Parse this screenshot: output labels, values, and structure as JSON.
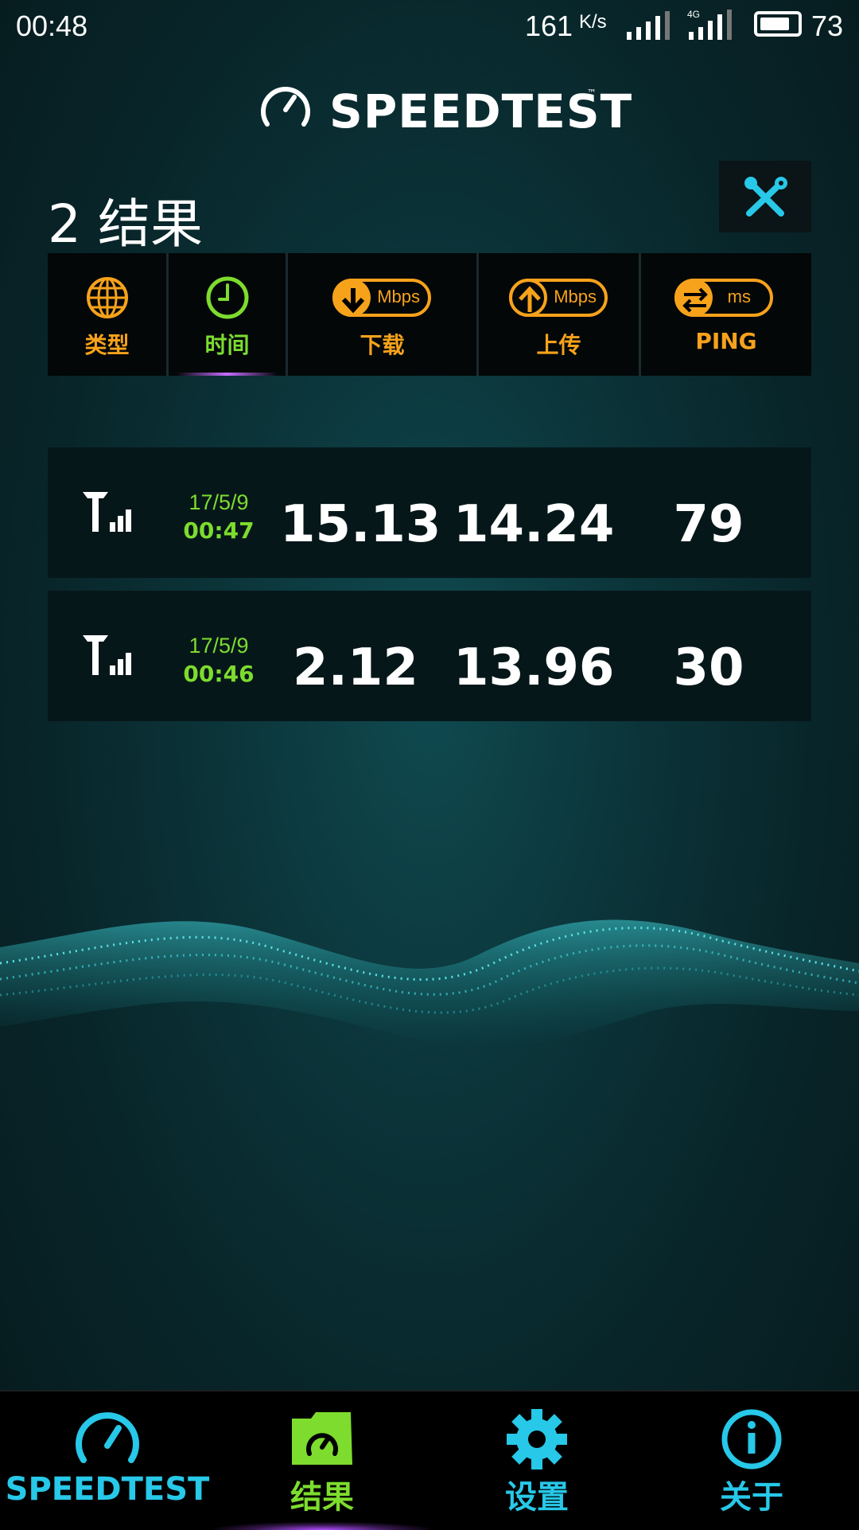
{
  "status_bar": {
    "time": "00:48",
    "net_speed": "161",
    "net_speed_unit": "K/s",
    "network_type": "4G",
    "battery": "73"
  },
  "app": {
    "logo_text": "SPEEDTEST",
    "trademark": "™"
  },
  "results": {
    "title": "2 结果",
    "tools_icon": "wrench-screwdriver-icon"
  },
  "columns": [
    {
      "label": "类型",
      "icon": "globe-icon"
    },
    {
      "label": "时间",
      "icon": "clock-icon",
      "active": true
    },
    {
      "label": "下载",
      "icon": "download-arrow-icon",
      "unit": "Mbps"
    },
    {
      "label": "上传",
      "icon": "upload-arrow-icon",
      "unit": "Mbps"
    },
    {
      "label": "PING",
      "icon": "ping-arrows-icon",
      "unit": "ms"
    }
  ],
  "rows": [
    {
      "date": "17/5/9",
      "time": "00:47",
      "download": "15.13",
      "upload": "14.24",
      "ping": "79",
      "type_icon": "cellular-signal-icon"
    },
    {
      "date": "17/5/9",
      "time": "00:46",
      "download": "2.12",
      "upload": "13.96",
      "ping": "30",
      "type_icon": "cellular-signal-icon"
    }
  ],
  "bottom_nav": [
    {
      "label": "SPEEDTEST",
      "icon": "speedometer-icon"
    },
    {
      "label": "结果",
      "icon": "results-folder-icon",
      "active": true
    },
    {
      "label": "设置",
      "icon": "gear-icon"
    },
    {
      "label": "关于",
      "icon": "info-icon"
    }
  ],
  "colors": {
    "accent_orange": "#f7a21b",
    "accent_green": "#7ddc2e",
    "accent_cyan": "#27c8e8",
    "highlight_purple": "#c86cff"
  }
}
